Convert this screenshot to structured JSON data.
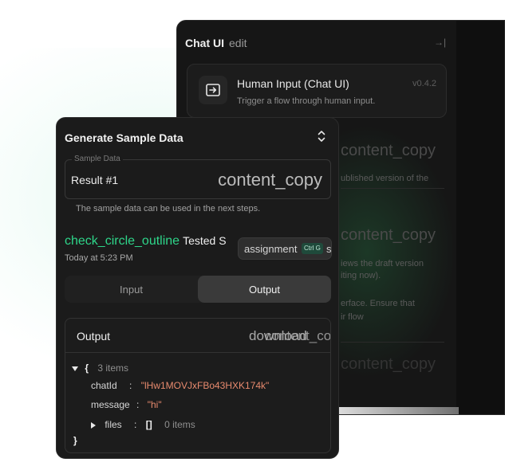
{
  "back_panel": {
    "title": "Chat UI",
    "edit_label": "edit",
    "collapse_icon": "→|",
    "node": {
      "title": "Human Input (Chat UI)",
      "description": "Trigger a flow through human input.",
      "version": "v0.4.2",
      "icon": "input-arrow-icon"
    },
    "copy_label_1": "content_copy",
    "published_text": "ublished version of the",
    "copy_label_2": "content_copy",
    "draft_text_1": "iews the draft version",
    "draft_text_2": "iting now).",
    "interface_text_1": "erface. Ensure that",
    "interface_text_2": "ir flow",
    "copy_label_3": "content_copy"
  },
  "front_panel": {
    "title": "Generate Sample Data",
    "sample": {
      "legend": "Sample Data",
      "value": "Result #1",
      "copy_label": "content_copy",
      "help": "The sample data can be used in the next steps."
    },
    "tested": {
      "icon_text": "check_circle_outline",
      "label": "Tested S",
      "time": "Today at 5:23 PM"
    },
    "assign_pill": {
      "text": "assignment",
      "kbd": "Ctrl G",
      "tail": "st"
    },
    "tabs": [
      {
        "label": "Input",
        "active": false
      },
      {
        "label": "Output",
        "active": true
      }
    ],
    "output": {
      "label": "Output",
      "action_a": "download",
      "action_b": "content_co"
    },
    "json": {
      "open_brace": "{",
      "count": "3 items",
      "rows": [
        {
          "key": "chatId",
          "colon": ":",
          "value": "\"lHw1MOVJxFBo43HXK174k\""
        },
        {
          "key": "message",
          "colon": ":",
          "value": "\"hi\""
        }
      ],
      "files_key": "files",
      "files_colon": ":",
      "files_value": "[]",
      "files_count": "0 items",
      "close_brace": "}"
    }
  },
  "colors": {
    "accent_green": "#2ed68a",
    "string_value": "#e88a6e",
    "panel_bg": "#1b1b1b"
  }
}
